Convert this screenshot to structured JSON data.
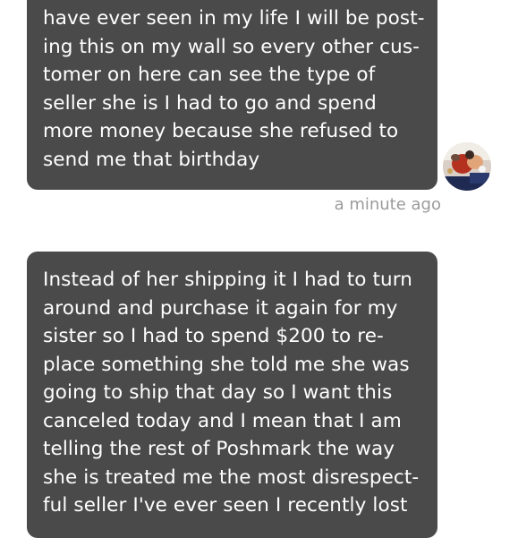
{
  "messages": [
    {
      "lines": [
        "have ever seen in my life I will be post-",
        "ing this on my wall so every other cus-",
        "tomer on here can see the type of",
        "seller she is I had to go and spend",
        "more money because she refused to",
        "send me that birthday"
      ],
      "timestamp": "a minute ago"
    },
    {
      "lines": [
        "Instead of her shipping it I had to turn",
        "around and purchase it again for my",
        "sister so I had to spend $200 to re-",
        "place something she told me she was",
        "going to ship that day so I want this",
        "canceled today and I mean that I am",
        "telling the rest of Poshmark the way",
        "she is treated me the most disrespect-",
        "ful seller I've ever seen I recently lost"
      ]
    }
  ],
  "avatar": {
    "icon": "user-avatar-photo"
  },
  "colors": {
    "bubble": "#4a4a4a",
    "bubble_text": "#ffffff",
    "timestamp": "#9b9b9b",
    "background": "#ffffff"
  }
}
